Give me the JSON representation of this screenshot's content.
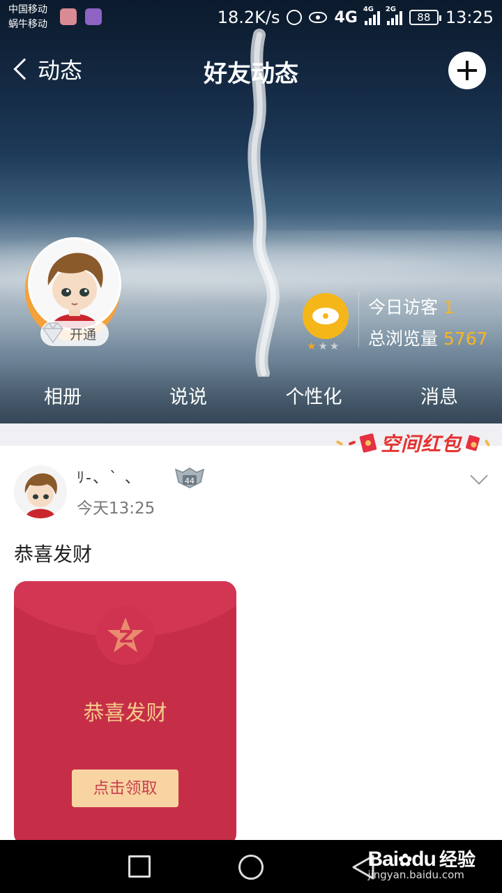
{
  "status_bar": {
    "carrier1": "中国移动",
    "carrier2": "蜗牛移动",
    "speed": "18.2K/s",
    "net1": "4G",
    "net_small1": "4G",
    "net_small2": "2G",
    "battery": "88",
    "time": "13:25"
  },
  "nav": {
    "back_label": "动态",
    "title": "好友动态"
  },
  "profile": {
    "vip_label": "开通",
    "visitors_label": "今日访客",
    "visitors_value": "1",
    "views_label": "总浏览量",
    "views_value": "5767",
    "stars_on": 1,
    "stars_total": 3
  },
  "cover_tabs": [
    "相册",
    "说说",
    "个性化",
    "消息"
  ],
  "banner": {
    "text": "空间红包"
  },
  "post": {
    "name": "ﾘ-、ˋ    、",
    "level": "44",
    "time": "今天13:25",
    "text": "恭喜发财",
    "redpacket": {
      "title": "恭喜发财",
      "button": "点击领取"
    }
  },
  "watermark": {
    "logo": "Bai",
    "logo2": "du",
    "text": "经验",
    "url": "jingyan.baidu.com"
  },
  "colors": {
    "accent": "#f7b526",
    "redpacket": "#c62e48",
    "banner": "#e5322f"
  }
}
